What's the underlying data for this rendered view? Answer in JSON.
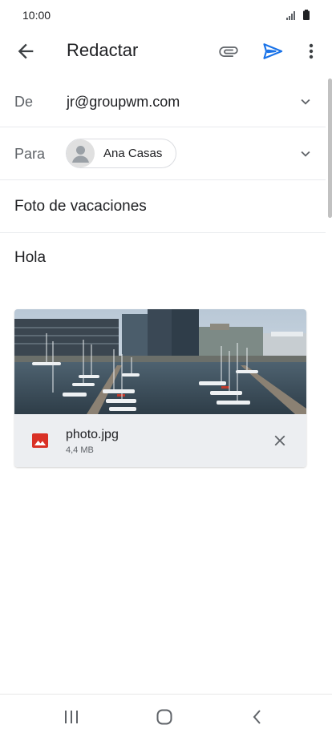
{
  "status_bar": {
    "time": "10:00",
    "icons": [
      "signal-icon",
      "battery-icon"
    ]
  },
  "toolbar": {
    "title": "Redactar",
    "icons": [
      "back-arrow-icon",
      "paperclip-icon",
      "send-icon",
      "more-vert-icon"
    ],
    "send_color": "#1a73e8"
  },
  "compose": {
    "from_label": "De",
    "from_value": "jr@groupwm.com",
    "to_label": "Para",
    "to_recipient": "Ana Casas",
    "subject": "Foto de vacaciones",
    "body": "Hola"
  },
  "attachment": {
    "filename": "photo.jpg",
    "size": "4,4 MB",
    "icon": "image-file-icon",
    "icon_color": "#d93025"
  },
  "nav_bar": {
    "icons": [
      "recent-apps-icon",
      "home-icon",
      "back-icon"
    ]
  }
}
